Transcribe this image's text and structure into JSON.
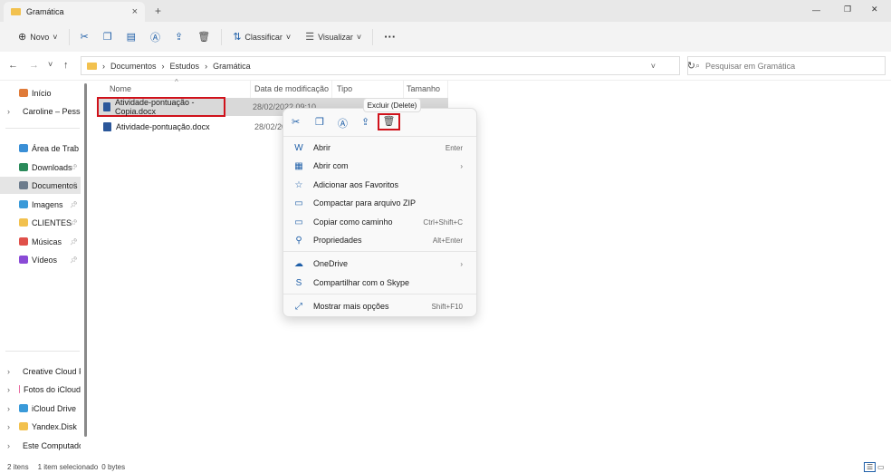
{
  "window": {
    "tab_title": "Gramática",
    "new_tab": "+",
    "close_tab": "×",
    "minimize": "—",
    "restore": "❐",
    "close": "✕"
  },
  "toolbar": {
    "new_label": "Novo",
    "sort_label": "Classificar",
    "view_label": "Visualizar",
    "more": "···"
  },
  "address": {
    "crumbs": [
      "Documentos",
      "Estudos",
      "Gramática"
    ],
    "search_placeholder": "Pesquisar em Gramática"
  },
  "sidebar": {
    "items": [
      {
        "label": "Início",
        "icon": "home"
      },
      {
        "label": "Caroline – Pesso",
        "icon": "onedrive",
        "expand": true
      },
      {
        "label": "Área de Trab",
        "icon": "desktop",
        "pinned": true
      },
      {
        "label": "Downloads",
        "icon": "download",
        "pinned": true
      },
      {
        "label": "Documentos",
        "icon": "documents",
        "pinned": true,
        "selected": true
      },
      {
        "label": "Imagens",
        "icon": "pictures",
        "pinned": true
      },
      {
        "label": "CLIENTES",
        "icon": "folder",
        "pinned": true
      },
      {
        "label": "Músicas",
        "icon": "music",
        "pinned": true
      },
      {
        "label": "Vídeos",
        "icon": "videos",
        "pinned": true
      },
      {
        "label": "Creative Cloud F",
        "icon": "creative-cloud",
        "expand": true
      },
      {
        "label": "Fotos do iCloud",
        "icon": "icloud-photos",
        "expand": true
      },
      {
        "label": "iCloud Drive",
        "icon": "icloud",
        "expand": true
      },
      {
        "label": "Yandex.Disk",
        "icon": "yandex",
        "expand": true
      },
      {
        "label": "Este Computado",
        "icon": "computer",
        "expand": true
      }
    ]
  },
  "columns": [
    "Nome",
    "Data de modificação",
    "Tipo",
    "Tamanho"
  ],
  "files": [
    {
      "name": "Atividade-pontuação - Copia.docx",
      "date": "28/02/2022 09:10",
      "selected": true
    },
    {
      "name": "Atividade-pontuação.docx",
      "date": "28/02/20"
    }
  ],
  "tooltip": "Excluir (Delete)",
  "context_menu": {
    "items": [
      {
        "label": "Abrir",
        "shortcut": "Enter",
        "icon": "W"
      },
      {
        "label": "Abrir com",
        "shortcut": "›",
        "icon": "▦"
      },
      {
        "label": "Adicionar aos Favoritos",
        "shortcut": "",
        "icon": "☆"
      },
      {
        "label": "Compactar para arquivo ZIP",
        "shortcut": "",
        "icon": "▭"
      },
      {
        "label": "Copiar como caminho",
        "shortcut": "Ctrl+Shift+C",
        "icon": "▭"
      },
      {
        "label": "Propriedades",
        "shortcut": "Alt+Enter",
        "icon": "⚲"
      },
      {
        "label": "OneDrive",
        "shortcut": "›",
        "icon": "☁"
      },
      {
        "label": "Compartilhar com o Skype",
        "shortcut": "",
        "icon": "S"
      },
      {
        "label": "Mostrar mais opções",
        "shortcut": "Shift+F10",
        "icon": "⤢"
      }
    ]
  },
  "status": {
    "count": "2 itens",
    "selected": "1 item selecionado",
    "size": "0 bytes"
  },
  "colors": {
    "accent": "#1f5fa8",
    "highlight": "#d0121b",
    "selected_row": "#d9d9d9"
  }
}
